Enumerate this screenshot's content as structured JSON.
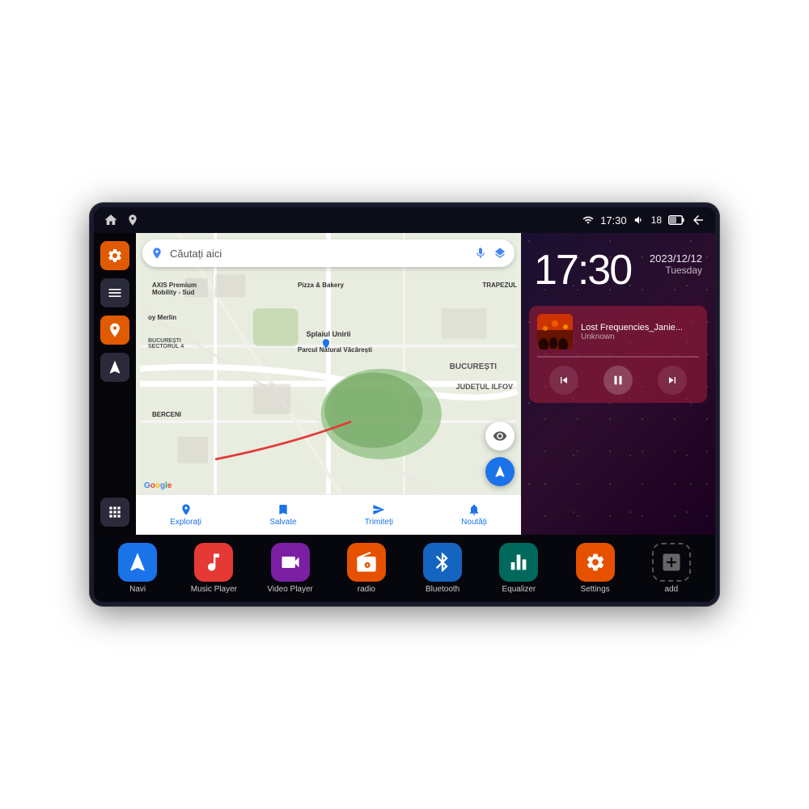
{
  "status_bar": {
    "time": "17:30",
    "battery": "18",
    "signal_icon": "▾",
    "wifi_icon": "▿",
    "back_icon": "↩"
  },
  "clock": {
    "time": "17:30",
    "date": "2023/12/12",
    "day": "Tuesday"
  },
  "music": {
    "title": "Lost Frequencies_Janie...",
    "artist": "Unknown",
    "prev_label": "⏮",
    "pause_label": "⏸",
    "next_label": "⏭"
  },
  "map": {
    "search_placeholder": "Căutați aici",
    "labels": [
      "AXIS Premium Mobility - Sud",
      "Pizza & Bakery",
      "TRAPEZUL",
      "Parcul Natural Văcărești",
      "BUCUREȘTI",
      "SECTORUL 4",
      "JUDEȚUL ILFOV",
      "BERCENI",
      "oy Merlin"
    ],
    "nav_items": [
      {
        "label": "Explorați",
        "icon": "📍"
      },
      {
        "label": "Salvate",
        "icon": "🔖"
      },
      {
        "label": "Trimiteți",
        "icon": "📤"
      },
      {
        "label": "Noutăți",
        "icon": "🔔"
      }
    ]
  },
  "sidebar": {
    "items": [
      {
        "icon": "⚙",
        "color": "orange",
        "name": "settings"
      },
      {
        "icon": "▤",
        "color": "dark",
        "name": "menu"
      },
      {
        "icon": "📍",
        "color": "orange",
        "name": "map"
      },
      {
        "icon": "▲",
        "color": "dark",
        "name": "nav"
      }
    ],
    "bottom_icon": "⊞"
  },
  "apps": [
    {
      "label": "Navi",
      "color": "blue-nav",
      "icon": "▲"
    },
    {
      "label": "Music Player",
      "color": "red-music",
      "icon": "♪"
    },
    {
      "label": "Video Player",
      "color": "purple-video",
      "icon": "▶"
    },
    {
      "label": "radio",
      "color": "orange-radio",
      "icon": "📶"
    },
    {
      "label": "Bluetooth",
      "color": "blue-bt",
      "icon": "ᛒ"
    },
    {
      "label": "Equalizer",
      "color": "teal-eq",
      "icon": "⫿"
    },
    {
      "label": "Settings",
      "color": "orange-settings",
      "icon": "⚙"
    },
    {
      "label": "add",
      "color": "gray-add",
      "icon": "+"
    }
  ]
}
